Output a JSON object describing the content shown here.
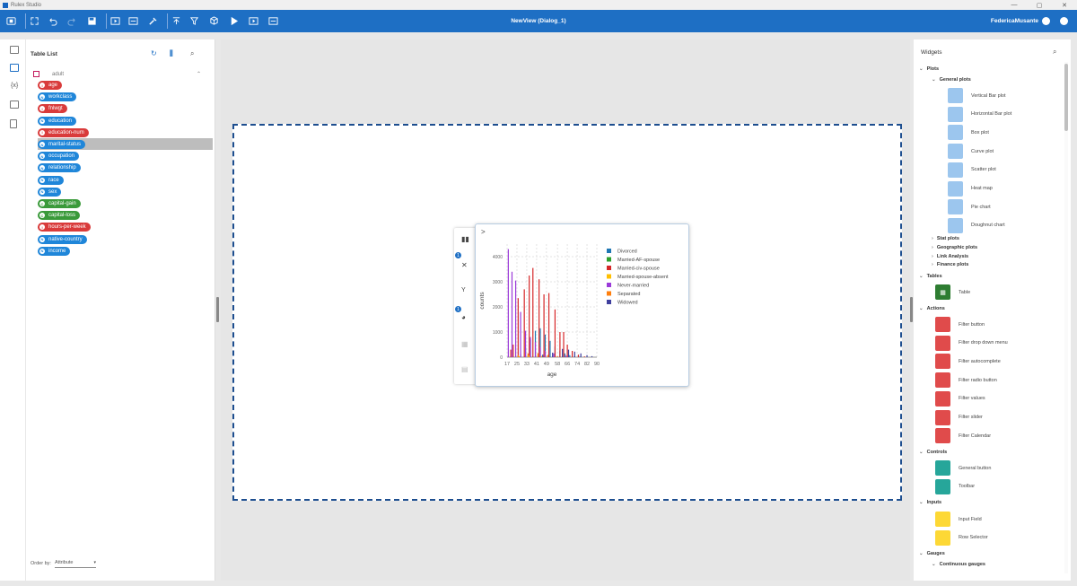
{
  "app": {
    "title": "Rulex Studio",
    "view_title": "NewView (Dialog_1)",
    "user": "FedericaMusante"
  },
  "titlebar": {
    "min": "—",
    "max": "▢",
    "close": "✕"
  },
  "toolbar": {
    "icons": [
      "home-icon",
      "fullscreen-icon",
      "undo-icon",
      "redo-icon",
      "save-icon",
      "present-icon",
      "layout-icon",
      "wrench-icon",
      "upload-icon",
      "filter-clear-icon",
      "cube-icon",
      "play-icon",
      "preview-icon",
      "export-icon"
    ]
  },
  "table_list": {
    "title": "Table List",
    "source": "adult",
    "order_by_label": "Order by:",
    "order_by_value": "Attribute",
    "attributes": [
      {
        "name": "age",
        "type": "I"
      },
      {
        "name": "workclass",
        "type": "N"
      },
      {
        "name": "fnlwgt",
        "type": "I"
      },
      {
        "name": "education",
        "type": "N"
      },
      {
        "name": "education-num",
        "type": "I"
      },
      {
        "name": "marital-status",
        "type": "N",
        "selected": true
      },
      {
        "name": "occupation",
        "type": "N"
      },
      {
        "name": "relationship",
        "type": "N"
      },
      {
        "name": "race",
        "type": "N"
      },
      {
        "name": "sex",
        "type": "N"
      },
      {
        "name": "capital-gain",
        "type": "C"
      },
      {
        "name": "capital-loss",
        "type": "C"
      },
      {
        "name": "hours-per-week",
        "type": "I"
      },
      {
        "name": "native-country",
        "type": "N"
      },
      {
        "name": "income",
        "type": "N"
      }
    ]
  },
  "left_rail": {
    "formula_label": "{x}"
  },
  "widget_panel": {
    "badges": [
      "1",
      "1"
    ],
    "expand": ">"
  },
  "chart_data": {
    "type": "bar",
    "xlabel": "age",
    "ylabel": "counts",
    "ylim": [
      0,
      4500
    ],
    "yticks": [
      0,
      1000,
      2000,
      3000,
      4000
    ],
    "xticks": [
      "17",
      "25",
      "33",
      "41",
      "49",
      "58",
      "66",
      "74",
      "82",
      "90"
    ],
    "xlim": [
      17,
      90
    ],
    "legend_position": "right",
    "series": [
      {
        "name": "Divorced",
        "color": "#1f77b4",
        "points": [
          [
            24,
            10
          ],
          [
            28,
            120
          ],
          [
            32,
            380
          ],
          [
            36,
            700
          ],
          [
            40,
            1050
          ],
          [
            44,
            1150
          ],
          [
            48,
            900
          ],
          [
            52,
            650
          ],
          [
            56,
            420
          ],
          [
            60,
            260
          ],
          [
            64,
            150
          ],
          [
            68,
            80
          ],
          [
            72,
            40
          ],
          [
            76,
            20
          ]
        ]
      },
      {
        "name": "Married-AF-spouse",
        "color": "#2ca02c",
        "points": [
          [
            25,
            5
          ],
          [
            33,
            5
          ],
          [
            41,
            3
          ]
        ]
      },
      {
        "name": "Married-civ-spouse",
        "color": "#d62728",
        "points": [
          [
            20,
            300
          ],
          [
            22,
            500
          ],
          [
            26,
            2350
          ],
          [
            31,
            2700
          ],
          [
            35,
            3250
          ],
          [
            38,
            3550
          ],
          [
            43,
            3100
          ],
          [
            47,
            2500
          ],
          [
            51,
            2550
          ],
          [
            56,
            1900
          ],
          [
            60,
            1000
          ],
          [
            63,
            1000
          ],
          [
            66,
            500
          ],
          [
            70,
            250
          ],
          [
            75,
            100
          ],
          [
            80,
            30
          ]
        ]
      },
      {
        "name": "Married-spouse-absent",
        "color": "#ffbf00",
        "points": [
          [
            27,
            40
          ],
          [
            35,
            60
          ],
          [
            45,
            50
          ],
          [
            55,
            30
          ]
        ]
      },
      {
        "name": "Never-married",
        "color": "#9b3ad9",
        "points": [
          [
            18,
            4300
          ],
          [
            21,
            3400
          ],
          [
            24,
            3050
          ],
          [
            28,
            1800
          ],
          [
            32,
            1050
          ],
          [
            36,
            800
          ],
          [
            40,
            600
          ],
          [
            44,
            400
          ],
          [
            48,
            250
          ],
          [
            55,
            150
          ],
          [
            65,
            60
          ]
        ]
      },
      {
        "name": "Separated",
        "color": "#ff7f0e",
        "points": [
          [
            26,
            80
          ],
          [
            34,
            150
          ],
          [
            42,
            160
          ],
          [
            50,
            90
          ],
          [
            58,
            40
          ]
        ]
      },
      {
        "name": "Widowed",
        "color": "#3f3f9e",
        "points": [
          [
            46,
            100
          ],
          [
            54,
            180
          ],
          [
            62,
            330
          ],
          [
            67,
            300
          ],
          [
            72,
            220
          ],
          [
            77,
            150
          ],
          [
            82,
            80
          ],
          [
            86,
            40
          ]
        ]
      }
    ]
  },
  "widgets": {
    "title": "Widgets",
    "plots": "Plots",
    "general_plots": "General plots",
    "general_items": [
      {
        "label": "Vertical Bar plot",
        "icon": "vertical-bar-plot-icon"
      },
      {
        "label": "Horizontal Bar plot",
        "icon": "horizontal-bar-plot-icon"
      },
      {
        "label": "Box plot",
        "icon": "box-plot-icon"
      },
      {
        "label": "Curve plot",
        "icon": "curve-plot-icon"
      },
      {
        "label": "Scatter plot",
        "icon": "scatter-plot-icon"
      },
      {
        "label": "Heat map",
        "icon": "heat-map-icon"
      },
      {
        "label": "Pie chart",
        "icon": "pie-chart-icon"
      },
      {
        "label": "Doughnut chart",
        "icon": "doughnut-chart-icon"
      }
    ],
    "collapsed_groups": [
      "Stat plots",
      "Geographic plots",
      "Link Analysis",
      "Finance plots"
    ],
    "tables": "Tables",
    "table_item": "Table",
    "actions": "Actions",
    "action_items": [
      "Filter button",
      "Filter drop down menu",
      "Filter autocomplete",
      "Filter radio button",
      "Filter values",
      "Filter slider",
      "Filter Calendar"
    ],
    "controls": "Controls",
    "control_items": [
      "General button",
      "Toolbar"
    ],
    "inputs": "Inputs",
    "input_items": [
      "Input Field",
      "Row Selector"
    ],
    "gauges": "Gauges",
    "gauge_sub": "Continuous gauges"
  }
}
